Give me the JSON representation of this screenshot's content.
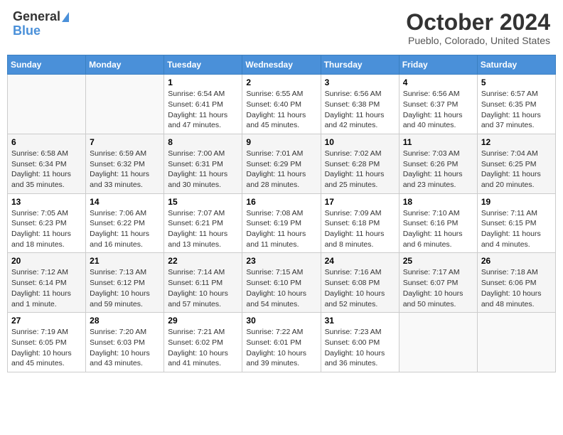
{
  "header": {
    "logo_general": "General",
    "logo_blue": "Blue",
    "month_title": "October 2024",
    "subtitle": "Pueblo, Colorado, United States"
  },
  "days_of_week": [
    "Sunday",
    "Monday",
    "Tuesday",
    "Wednesday",
    "Thursday",
    "Friday",
    "Saturday"
  ],
  "weeks": [
    [
      {
        "day": "",
        "sunrise": "",
        "sunset": "",
        "daylight": ""
      },
      {
        "day": "",
        "sunrise": "",
        "sunset": "",
        "daylight": ""
      },
      {
        "day": "1",
        "sunrise": "Sunrise: 6:54 AM",
        "sunset": "Sunset: 6:41 PM",
        "daylight": "Daylight: 11 hours and 47 minutes."
      },
      {
        "day": "2",
        "sunrise": "Sunrise: 6:55 AM",
        "sunset": "Sunset: 6:40 PM",
        "daylight": "Daylight: 11 hours and 45 minutes."
      },
      {
        "day": "3",
        "sunrise": "Sunrise: 6:56 AM",
        "sunset": "Sunset: 6:38 PM",
        "daylight": "Daylight: 11 hours and 42 minutes."
      },
      {
        "day": "4",
        "sunrise": "Sunrise: 6:56 AM",
        "sunset": "Sunset: 6:37 PM",
        "daylight": "Daylight: 11 hours and 40 minutes."
      },
      {
        "day": "5",
        "sunrise": "Sunrise: 6:57 AM",
        "sunset": "Sunset: 6:35 PM",
        "daylight": "Daylight: 11 hours and 37 minutes."
      }
    ],
    [
      {
        "day": "6",
        "sunrise": "Sunrise: 6:58 AM",
        "sunset": "Sunset: 6:34 PM",
        "daylight": "Daylight: 11 hours and 35 minutes."
      },
      {
        "day": "7",
        "sunrise": "Sunrise: 6:59 AM",
        "sunset": "Sunset: 6:32 PM",
        "daylight": "Daylight: 11 hours and 33 minutes."
      },
      {
        "day": "8",
        "sunrise": "Sunrise: 7:00 AM",
        "sunset": "Sunset: 6:31 PM",
        "daylight": "Daylight: 11 hours and 30 minutes."
      },
      {
        "day": "9",
        "sunrise": "Sunrise: 7:01 AM",
        "sunset": "Sunset: 6:29 PM",
        "daylight": "Daylight: 11 hours and 28 minutes."
      },
      {
        "day": "10",
        "sunrise": "Sunrise: 7:02 AM",
        "sunset": "Sunset: 6:28 PM",
        "daylight": "Daylight: 11 hours and 25 minutes."
      },
      {
        "day": "11",
        "sunrise": "Sunrise: 7:03 AM",
        "sunset": "Sunset: 6:26 PM",
        "daylight": "Daylight: 11 hours and 23 minutes."
      },
      {
        "day": "12",
        "sunrise": "Sunrise: 7:04 AM",
        "sunset": "Sunset: 6:25 PM",
        "daylight": "Daylight: 11 hours and 20 minutes."
      }
    ],
    [
      {
        "day": "13",
        "sunrise": "Sunrise: 7:05 AM",
        "sunset": "Sunset: 6:23 PM",
        "daylight": "Daylight: 11 hours and 18 minutes."
      },
      {
        "day": "14",
        "sunrise": "Sunrise: 7:06 AM",
        "sunset": "Sunset: 6:22 PM",
        "daylight": "Daylight: 11 hours and 16 minutes."
      },
      {
        "day": "15",
        "sunrise": "Sunrise: 7:07 AM",
        "sunset": "Sunset: 6:21 PM",
        "daylight": "Daylight: 11 hours and 13 minutes."
      },
      {
        "day": "16",
        "sunrise": "Sunrise: 7:08 AM",
        "sunset": "Sunset: 6:19 PM",
        "daylight": "Daylight: 11 hours and 11 minutes."
      },
      {
        "day": "17",
        "sunrise": "Sunrise: 7:09 AM",
        "sunset": "Sunset: 6:18 PM",
        "daylight": "Daylight: 11 hours and 8 minutes."
      },
      {
        "day": "18",
        "sunrise": "Sunrise: 7:10 AM",
        "sunset": "Sunset: 6:16 PM",
        "daylight": "Daylight: 11 hours and 6 minutes."
      },
      {
        "day": "19",
        "sunrise": "Sunrise: 7:11 AM",
        "sunset": "Sunset: 6:15 PM",
        "daylight": "Daylight: 11 hours and 4 minutes."
      }
    ],
    [
      {
        "day": "20",
        "sunrise": "Sunrise: 7:12 AM",
        "sunset": "Sunset: 6:14 PM",
        "daylight": "Daylight: 11 hours and 1 minute."
      },
      {
        "day": "21",
        "sunrise": "Sunrise: 7:13 AM",
        "sunset": "Sunset: 6:12 PM",
        "daylight": "Daylight: 10 hours and 59 minutes."
      },
      {
        "day": "22",
        "sunrise": "Sunrise: 7:14 AM",
        "sunset": "Sunset: 6:11 PM",
        "daylight": "Daylight: 10 hours and 57 minutes."
      },
      {
        "day": "23",
        "sunrise": "Sunrise: 7:15 AM",
        "sunset": "Sunset: 6:10 PM",
        "daylight": "Daylight: 10 hours and 54 minutes."
      },
      {
        "day": "24",
        "sunrise": "Sunrise: 7:16 AM",
        "sunset": "Sunset: 6:08 PM",
        "daylight": "Daylight: 10 hours and 52 minutes."
      },
      {
        "day": "25",
        "sunrise": "Sunrise: 7:17 AM",
        "sunset": "Sunset: 6:07 PM",
        "daylight": "Daylight: 10 hours and 50 minutes."
      },
      {
        "day": "26",
        "sunrise": "Sunrise: 7:18 AM",
        "sunset": "Sunset: 6:06 PM",
        "daylight": "Daylight: 10 hours and 48 minutes."
      }
    ],
    [
      {
        "day": "27",
        "sunrise": "Sunrise: 7:19 AM",
        "sunset": "Sunset: 6:05 PM",
        "daylight": "Daylight: 10 hours and 45 minutes."
      },
      {
        "day": "28",
        "sunrise": "Sunrise: 7:20 AM",
        "sunset": "Sunset: 6:03 PM",
        "daylight": "Daylight: 10 hours and 43 minutes."
      },
      {
        "day": "29",
        "sunrise": "Sunrise: 7:21 AM",
        "sunset": "Sunset: 6:02 PM",
        "daylight": "Daylight: 10 hours and 41 minutes."
      },
      {
        "day": "30",
        "sunrise": "Sunrise: 7:22 AM",
        "sunset": "Sunset: 6:01 PM",
        "daylight": "Daylight: 10 hours and 39 minutes."
      },
      {
        "day": "31",
        "sunrise": "Sunrise: 7:23 AM",
        "sunset": "Sunset: 6:00 PM",
        "daylight": "Daylight: 10 hours and 36 minutes."
      },
      {
        "day": "",
        "sunrise": "",
        "sunset": "",
        "daylight": ""
      },
      {
        "day": "",
        "sunrise": "",
        "sunset": "",
        "daylight": ""
      }
    ]
  ]
}
